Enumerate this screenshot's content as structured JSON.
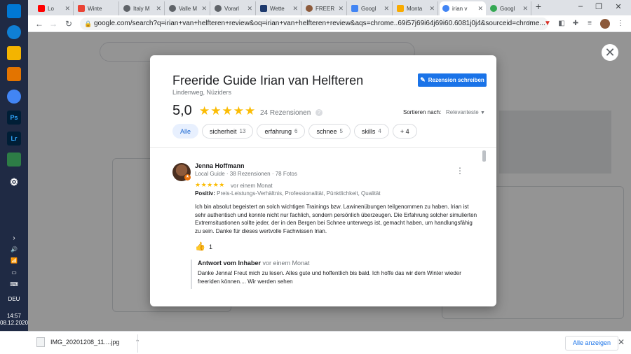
{
  "taskbar": {
    "lang": "DEU",
    "time": "14:57",
    "date": "08.12.2020",
    "notif_count": "2"
  },
  "browser": {
    "tabs": [
      {
        "label": "Lo",
        "color": "#ff0000"
      },
      {
        "label": "Winte",
        "color": "#ea4335"
      },
      {
        "label": "Italy M",
        "color": "#5f6368"
      },
      {
        "label": "Valle M",
        "color": "#5f6368"
      },
      {
        "label": "Vorarl",
        "color": "#5f6368"
      },
      {
        "label": "Wette",
        "color": "#1e3a6e"
      },
      {
        "label": "FREER",
        "color": "#8d5a3b"
      },
      {
        "label": "Googl",
        "color": "#4285f4"
      },
      {
        "label": "Monta",
        "color": "#f9ab00"
      },
      {
        "label": "irian v",
        "color": "#4285f4"
      },
      {
        "label": "Googl",
        "color": "#34a853"
      }
    ],
    "url": "google.com/search?q=irian+van+helfteren+review&oq=irian+van+helfteren+review&aqs=chrome..69i57j69i64j69i60.6081j0j4&sourceid=chrome..."
  },
  "dialog": {
    "title": "Freeride Guide Irian van Helfteren",
    "address": "Lindenweg, Nüziders",
    "write_review": "Rezension schreiben",
    "rating": "5,0",
    "stars": "★★★★★",
    "review_count": "24 Rezensionen",
    "sort_label": "Sortieren nach:",
    "sort_value": "Relevanteste",
    "chips": [
      {
        "label": "Alle",
        "count": ""
      },
      {
        "label": "sicherheit",
        "count": "13"
      },
      {
        "label": "erfahrung",
        "count": "6"
      },
      {
        "label": "schnee",
        "count": "5"
      },
      {
        "label": "skills",
        "count": "4"
      },
      {
        "label": "+ 4",
        "count": ""
      }
    ],
    "review": {
      "author": "Jenna Hoffmann",
      "meta": "Local Guide · 38 Rezensionen · 78 Fotos",
      "stars": "★★★★★",
      "date": "vor einem Monat",
      "positive_label": "Positiv:",
      "positive_text": "Preis-Leistungs-Verhältnis, Professionalität, Pünktlichkeit, Qualität",
      "text": "Ich bin absolut begeistert an solch wichtigen Trainings bzw. Lawinenübungen teilgenommen zu haben. Irian ist sehr authentisch und konnte nicht nur fachlich, sondern persönlich überzeugen. Die Erfahrung solcher simulierten Extremsituationen sollte jeder, der in den Bergen bei Schnee unterwegs ist, gemacht haben, um handlungsfähig zu sein. Danke für dieses wertvolle Fachwissen Irian.",
      "likes": "1"
    },
    "owner_reply": {
      "label": "Antwort vom Inhaber",
      "date": "vor einem Monat",
      "text": "Danke Jenna! Freut mich zu lesen. Alles gute und hoffentlich bis bald. Ich hoffe das wir dem Winter wieder freeriden können.... Wir werden sehen"
    }
  },
  "downloads": {
    "file": "IMG_20201208_11....jpg",
    "show_all": "Alle anzeigen"
  }
}
